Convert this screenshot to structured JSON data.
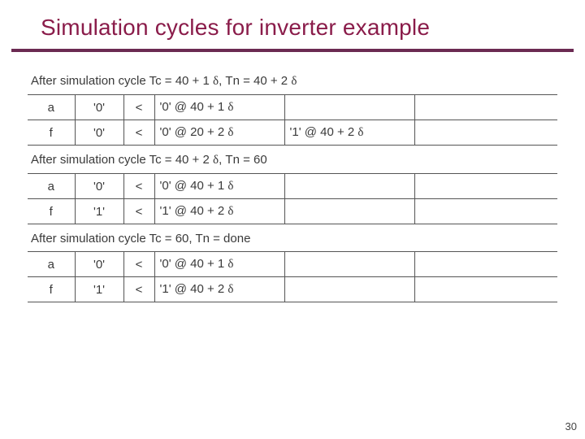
{
  "title": "Simulation cycles for inverter example",
  "page_number": "30",
  "delta_glyph": "δ",
  "cycles": [
    {
      "header_prefix": "After simulation cycle Tc = 40 + 1 ",
      "header_mid": ", Tn = 40 + 2 ",
      "header_suffix": "",
      "header_has_delta_mid": true,
      "header_has_delta_end": true,
      "rows": [
        {
          "sig": "a",
          "val": "'0'",
          "op": "<",
          "c3_pre": "'0' @ 40 + 1 ",
          "c3_delta": true,
          "c4_pre": "",
          "c4_delta": false
        },
        {
          "sig": "f",
          "val": "'0'",
          "op": "<",
          "c3_pre": "'0' @ 20 + 2 ",
          "c3_delta": true,
          "c4_pre": "'1' @ 40 + 2 ",
          "c4_delta": true
        }
      ]
    },
    {
      "header_prefix": "After simulation cycle Tc = 40 + 2 ",
      "header_mid": ", Tn = 60",
      "header_suffix": "",
      "header_has_delta_mid": true,
      "header_has_delta_end": false,
      "rows": [
        {
          "sig": "a",
          "val": "'0'",
          "op": "<",
          "c3_pre": "'0' @ 40 + 1 ",
          "c3_delta": true,
          "c4_pre": "",
          "c4_delta": false
        },
        {
          "sig": "f",
          "val": "'1'",
          "op": "<",
          "c3_pre": "'1' @ 40 + 2 ",
          "c3_delta": true,
          "c4_pre": "",
          "c4_delta": false
        }
      ]
    },
    {
      "header_prefix": "After simulation cycle Tc = 60, Tn = done",
      "header_mid": "",
      "header_suffix": "",
      "header_has_delta_mid": false,
      "header_has_delta_end": false,
      "rows": [
        {
          "sig": "a",
          "val": "'0'",
          "op": "<",
          "c3_pre": "'0' @ 40 + 1 ",
          "c3_delta": true,
          "c4_pre": "",
          "c4_delta": false
        },
        {
          "sig": "f",
          "val": "'1'",
          "op": "<",
          "c3_pre": "'1' @ 40 + 2 ",
          "c3_delta": true,
          "c4_pre": "",
          "c4_delta": false
        }
      ]
    }
  ]
}
